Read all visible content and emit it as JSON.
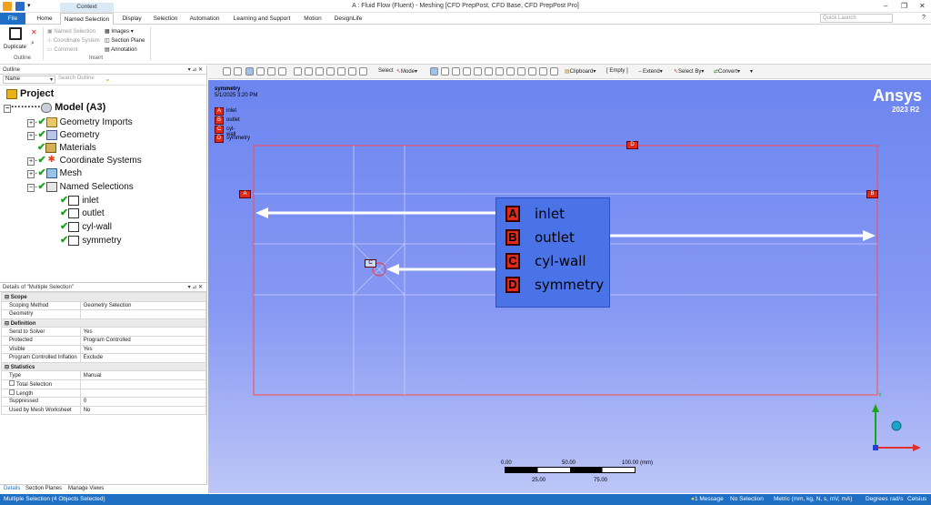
{
  "window": {
    "title": "A : Fluid Flow (Fluent) - Meshing [CFD PrepPost, CFD Base, CFD PrepPost Pro]"
  },
  "tabs": {
    "context_label": "Context",
    "file": "File",
    "home": "Home",
    "named_selection": "Named Selection",
    "display": "Display",
    "selection": "Selection",
    "automation": "Automation",
    "learning": "Learning and Support",
    "motion": "Motion",
    "designlife": "DesignLife",
    "quick_search_placeholder": "Quick Launch"
  },
  "ribbon": {
    "duplicate": "Duplicate",
    "outline_group": "Outline",
    "named_selection": "Named Selection",
    "coordinate_system": "Coordinate System",
    "comment": "Comment",
    "images": "Images",
    "section_plane": "Section Plane",
    "annotation": "Annotation",
    "insert_group": "Insert"
  },
  "toolbar": {
    "select": "Select",
    "mode": "Mode",
    "clipboard": "Clipboard",
    "empty": "[ Empty ]",
    "extend": "Extend",
    "select_by": "Select By",
    "convert": "Convert"
  },
  "outline": {
    "title": "Outline",
    "name_col": "Name",
    "search_placeholder": "Search Outline",
    "project": "Project",
    "model": "Model (A3)",
    "geometry_imports": "Geometry Imports",
    "geometry": "Geometry",
    "materials": "Materials",
    "coordinate_systems": "Coordinate Systems",
    "mesh": "Mesh",
    "named_selections": "Named Selections",
    "inlet": "inlet",
    "outlet": "outlet",
    "cylwall": "cyl-wall",
    "symmetry": "symmetry"
  },
  "details": {
    "title": "Details of \"Multiple Selection\"",
    "scope": "Scope",
    "scoping_method_k": "Scoping Method",
    "scoping_method_v": "Geometry Selection",
    "geometry_k": "Geometry",
    "geometry_v": "",
    "definition": "Definition",
    "send_k": "Send to Solver",
    "send_v": "Yes",
    "protected_k": "Protected",
    "protected_v": "Program Controlled",
    "visible_k": "Visible",
    "visible_v": "Yes",
    "inflation_k": "Program Controlled Inflation",
    "inflation_v": "Exclude",
    "statistics": "Statistics",
    "type_k": "Type",
    "type_v": "Manual",
    "total_k": "Total Selection",
    "total_v": "",
    "length_k": "Length",
    "length_v": "",
    "suppressed_k": "Suppressed",
    "suppressed_v": "0",
    "used_k": "Used by Mesh Worksheet",
    "used_v": "No"
  },
  "bottom_tabs": {
    "details": "Details",
    "section_planes": "Section Planes",
    "manage_views": "Manage Views"
  },
  "viewport": {
    "view_name": "symmetry",
    "timestamp": "5/1/2025 3:20 PM",
    "brand": "Ansys",
    "version": "2023 R2",
    "small_legend": [
      {
        "letter": "A",
        "label": "inlet"
      },
      {
        "letter": "B",
        "label": "outlet"
      },
      {
        "letter": "C",
        "label": "cyl-wall"
      },
      {
        "letter": "D",
        "label": "symmetry"
      }
    ],
    "big_legend": [
      {
        "letter": "A",
        "label": "inlet"
      },
      {
        "letter": "B",
        "label": "outlet"
      },
      {
        "letter": "C",
        "label": "cyl-wall"
      },
      {
        "letter": "D",
        "label": "symmetry"
      }
    ],
    "scale": {
      "t0": "0.00",
      "t1": "50.00",
      "t2": "100.00 (mm)",
      "b1": "25.00",
      "b2": "75.00"
    }
  },
  "status": {
    "left": "Multiple Selection (4 Objects Selected)",
    "messages": "1 Message",
    "selection": "No Selection",
    "units": "Metric (mm, kg, N, s, mV, mA)",
    "degrees": "Degrees",
    "rads": "rad/s",
    "celsius": "Celsius"
  },
  "colors": {
    "accent": "#1f6fc4",
    "tag_red": "#e02a1a",
    "check_green": "#1aa41a",
    "legend_bg": "#4a73e8"
  }
}
